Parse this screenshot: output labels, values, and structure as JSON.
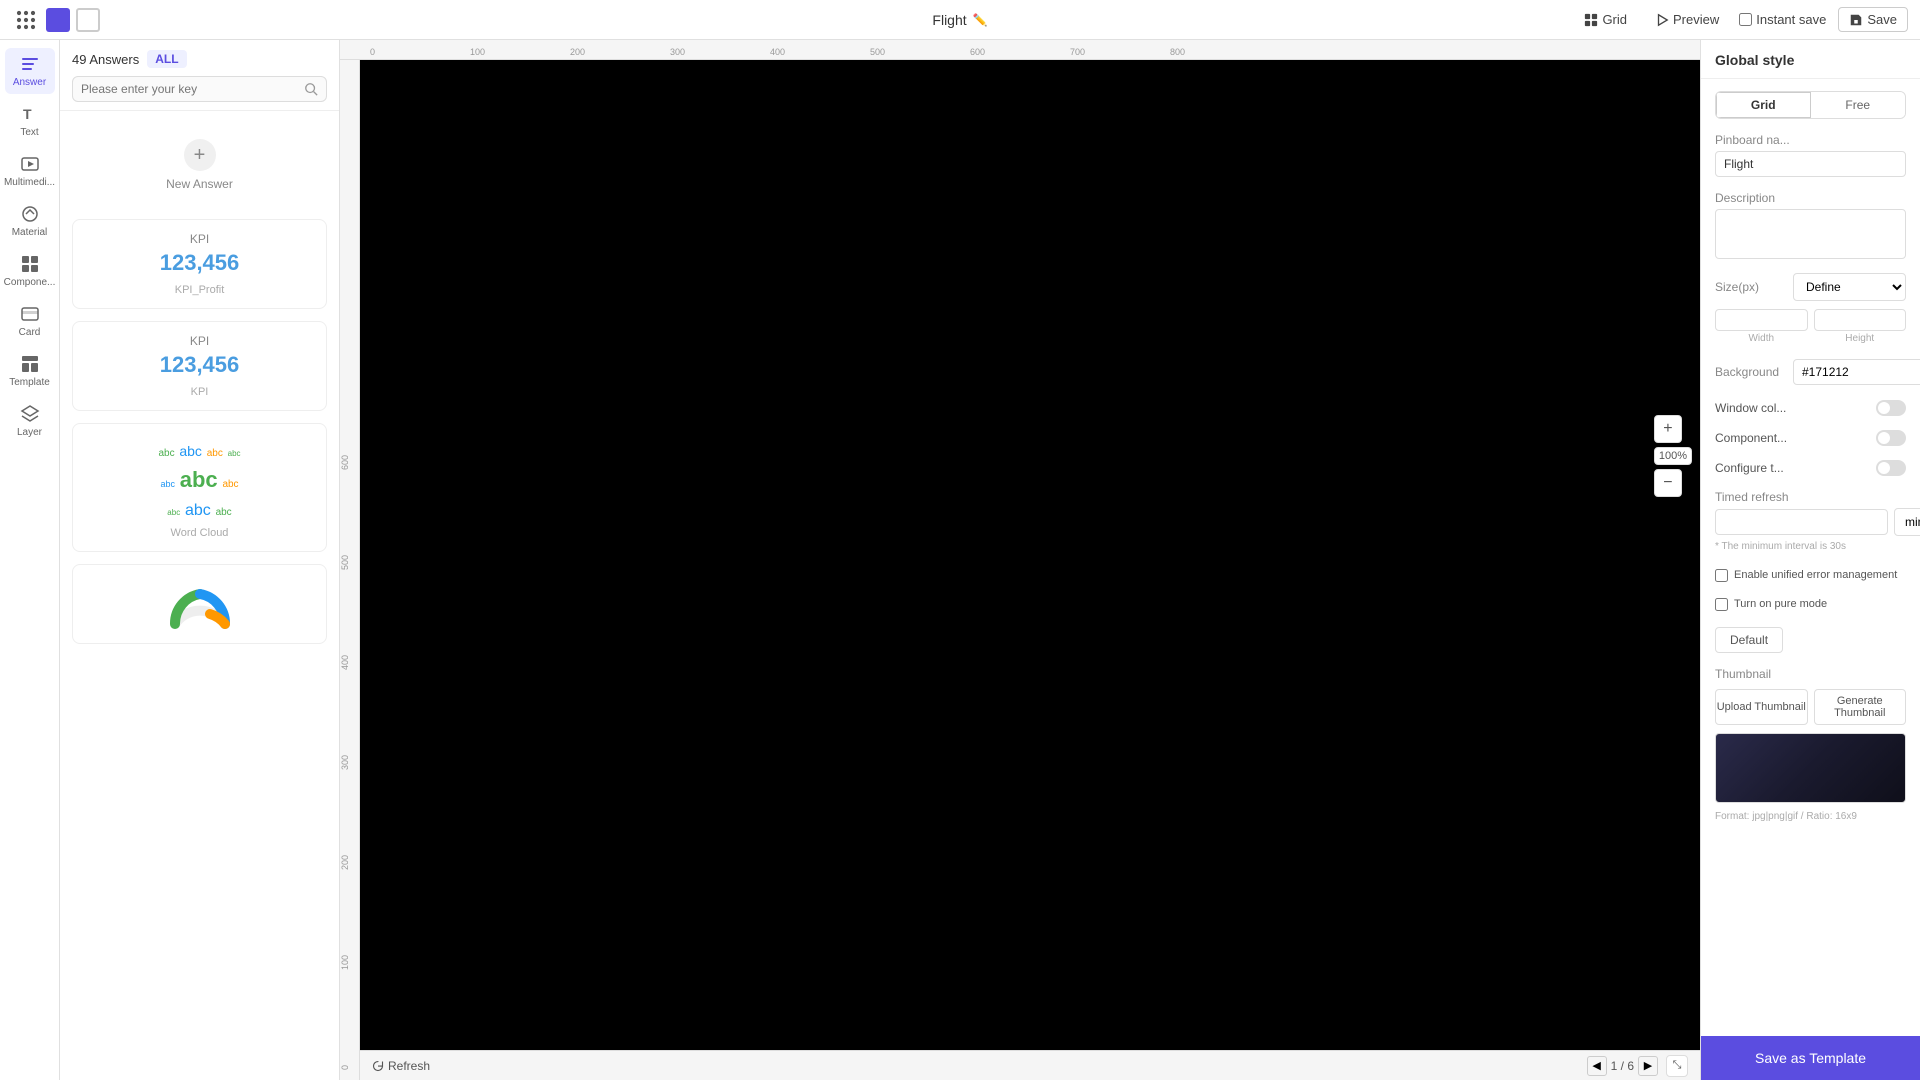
{
  "topbar": {
    "title": "Flight",
    "grid_label": "Grid",
    "preview_label": "Preview",
    "instant_save_label": "Instant save",
    "save_label": "Save",
    "zoom_level": "100%"
  },
  "left_sidebar": {
    "items": [
      {
        "id": "answer",
        "label": "Answer",
        "active": true
      },
      {
        "id": "text",
        "label": "Text",
        "active": false
      },
      {
        "id": "multimedia",
        "label": "Multimedi...",
        "active": false
      },
      {
        "id": "material",
        "label": "Material",
        "active": false
      },
      {
        "id": "component",
        "label": "Compone...",
        "active": false
      },
      {
        "id": "card",
        "label": "Card",
        "active": false
      },
      {
        "id": "template",
        "label": "Template",
        "active": false
      },
      {
        "id": "layer",
        "label": "Layer",
        "active": false
      }
    ]
  },
  "answers_panel": {
    "count": "49 Answers",
    "tab_all": "ALL",
    "search_placeholder": "Please enter your key",
    "new_answer_label": "New Answer",
    "cards": [
      {
        "type": "kpi",
        "label": "KPI",
        "value": "123,456",
        "name": "KPI_Profit"
      },
      {
        "type": "kpi",
        "label": "KPI",
        "value": "123,456",
        "name": "KPI"
      },
      {
        "type": "wordcloud",
        "label": "Word Cloud"
      }
    ]
  },
  "canvas": {
    "page_current": "1",
    "page_total": "6",
    "refresh_label": "Refresh",
    "background": "#000000"
  },
  "right_panel": {
    "title": "Global style",
    "layout_grid": "Grid",
    "layout_free": "Free",
    "pinboard_name_label": "Pinboard na...",
    "pinboard_name_value": "Flight",
    "description_label": "Description",
    "description_value": "",
    "size_label": "Size(px)",
    "size_option": "Define",
    "width_label": "Width",
    "height_label": "Height",
    "width_value": "",
    "height_value": "",
    "background_label": "Background",
    "background_value": "#171212",
    "window_color_label": "Window col...",
    "component_label": "Component...",
    "configure_label": "Configure t...",
    "timed_refresh_label": "Timed refresh",
    "timed_refresh_value": "",
    "timed_refresh_unit": "minute",
    "refresh_note": "* The minimum interval is 30s",
    "error_management_label": "Enable unified error management",
    "pure_mode_label": "Turn on pure mode",
    "default_btn_label": "Default",
    "thumbnail_label": "Thumbnail",
    "upload_label": "Upload Thumbnail",
    "generate_label": "Generate Thumbnail",
    "thumbnail_format": "Format: jpg|png|gif / Ratio: 16x9",
    "save_template_label": "Save as Template"
  },
  "word_cloud_words": [
    {
      "text": "abc",
      "size": 10,
      "color": "#4caf50"
    },
    {
      "text": "abc",
      "size": 14,
      "color": "#2196f3"
    },
    {
      "text": "abc",
      "size": 18,
      "color": "#4caf50"
    },
    {
      "text": "abc",
      "size": 10,
      "color": "#ff9800"
    },
    {
      "text": "abc",
      "size": 22,
      "color": "#4caf50"
    },
    {
      "text": "abc",
      "size": 12,
      "color": "#2196f3"
    },
    {
      "text": "abc",
      "size": 16,
      "color": "#4caf50"
    },
    {
      "text": "abc",
      "size": 10,
      "color": "#ff9800"
    },
    {
      "text": "abc",
      "size": 20,
      "color": "#4caf50"
    }
  ]
}
